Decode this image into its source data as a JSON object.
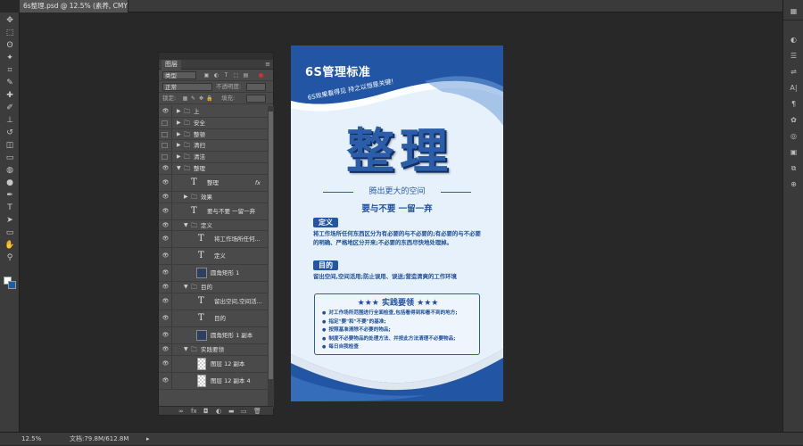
{
  "document_tab": {
    "title": "6s整理.psd @ 12.5% (素养, CMYK/8) *",
    "close": "×"
  },
  "toolbar": {
    "tools": [
      "move-tool",
      "marquee-tool",
      "lasso-tool",
      "magic-wand-tool",
      "crop-tool",
      "eyedropper-tool",
      "healing-brush-tool",
      "brush-tool",
      "clone-stamp-tool",
      "history-brush-tool",
      "eraser-tool",
      "gradient-tool",
      "blur-tool",
      "dodge-tool",
      "pen-tool",
      "type-tool",
      "path-selection-tool",
      "shape-tool",
      "hand-tool",
      "zoom-tool"
    ],
    "glyphs": [
      "✥",
      "⬚",
      "ʘ",
      "✦",
      "⌗",
      "✎",
      "✚",
      "✐",
      "⊥",
      "↺",
      "◫",
      "▭",
      "◍",
      "●",
      "✒",
      "T",
      "➤",
      "▭",
      "✋",
      "⚲"
    ],
    "fg_color": "#ffffff",
    "bg_color": "#1a5fa5"
  },
  "right_dock": {
    "glyphs": [
      "▦",
      "◐",
      "☰",
      "⇌",
      "A|",
      "¶",
      "✿",
      "◎",
      "▣",
      "⧉",
      "⊕"
    ]
  },
  "status_bar": {
    "zoom": "12.5%",
    "doc": "文档:79.8M/612.8M",
    "arrow": "▸"
  },
  "layers_panel": {
    "title": "图层",
    "menu_icon": "≡",
    "kind_label": "类型",
    "mode_label": "正常",
    "opacity_label": "不透明度:",
    "lock_label": "锁定:",
    "fill_label": "填充:",
    "footer_icons": [
      "∞",
      "fx",
      "◘",
      "◐",
      "▬",
      "▭",
      "🗑"
    ],
    "layers": [
      {
        "type": "group",
        "name": "上",
        "visible": true,
        "expanded": false,
        "indent": 0
      },
      {
        "type": "group",
        "name": "安全",
        "visible": false,
        "expanded": false,
        "indent": 0
      },
      {
        "type": "group",
        "name": "整顿",
        "visible": false,
        "expanded": false,
        "indent": 0
      },
      {
        "type": "group",
        "name": "清扫",
        "visible": false,
        "expanded": false,
        "indent": 0
      },
      {
        "type": "group",
        "name": "清洁",
        "visible": false,
        "expanded": false,
        "indent": 0
      },
      {
        "type": "group",
        "name": "整理",
        "visible": true,
        "expanded": true,
        "indent": 0
      },
      {
        "type": "text",
        "name": "整理",
        "visible": true,
        "indent": 1,
        "fx": "fx",
        "tall": true
      },
      {
        "type": "group",
        "name": "效果",
        "visible": true,
        "expanded": false,
        "indent": 1
      },
      {
        "type": "text",
        "name": "要与不要 一留一弃",
        "visible": true,
        "indent": 1,
        "tall": true
      },
      {
        "type": "group",
        "name": "定义",
        "visible": true,
        "expanded": true,
        "indent": 1
      },
      {
        "type": "text",
        "name": "将工作场所任何...",
        "visible": true,
        "indent": 2,
        "tall": true
      },
      {
        "type": "text",
        "name": "定义",
        "visible": true,
        "indent": 2,
        "tall": true
      },
      {
        "type": "shape",
        "name": "圆角矩形 1",
        "visible": true,
        "indent": 2,
        "tall": true
      },
      {
        "type": "group",
        "name": "目的",
        "visible": true,
        "expanded": true,
        "indent": 1
      },
      {
        "type": "text",
        "name": "留出空间,空间活...",
        "visible": true,
        "indent": 2,
        "tall": true
      },
      {
        "type": "text",
        "name": "目的",
        "visible": true,
        "indent": 2,
        "tall": true
      },
      {
        "type": "shape",
        "name": "圆角矩形 1 副本",
        "visible": true,
        "indent": 2,
        "tall": true
      },
      {
        "type": "group",
        "name": "实践要领",
        "visible": true,
        "expanded": true,
        "indent": 1
      },
      {
        "type": "pixel",
        "name": "图层 12 副本",
        "visible": true,
        "indent": 2,
        "tall": true
      },
      {
        "type": "pixel",
        "name": "图层 12 副本 4",
        "visible": true,
        "indent": 2,
        "tall": true
      }
    ]
  },
  "poster": {
    "title": "6S管理标准",
    "slogan": "6S效果看得见 持之以恒是关键!",
    "big_text": "整理",
    "subtitle": "腾出更大的空间",
    "motto": "要与不要 一留一弃",
    "def_badge": "定义",
    "def_text": "将工作场所任何东西区分为有必要的与不必要的;有必要的与不必要的明确、严格地区分开来;不必要的东西尽快地处理掉。",
    "goal_badge": "目的",
    "goal_text": "留出空间,空间活用;防止误用、误送;营造清爽的工作环境",
    "practice_title": "★★★ 实践要领 ★★★",
    "practice_items": [
      "对工作场所范围进行全面检查,包括看得到和看不到的地方;",
      "指定\"要\"和\"不要\"的基准;",
      "按照基准清除不必要的物品;",
      "制度不必要物品的处理方法、并按此方法清理不必要物品;",
      "每日自我检查"
    ],
    "colors": {
      "primary": "#2256a4",
      "light_bg": "#e7f1fb",
      "text": "#1f4f9c"
    }
  }
}
